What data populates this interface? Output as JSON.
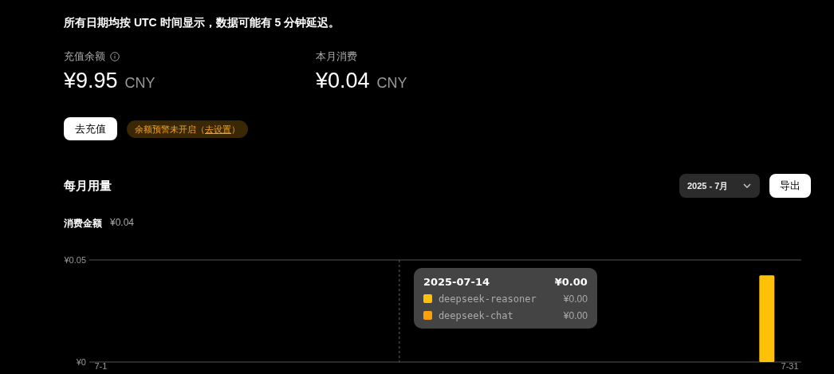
{
  "notice": "所有日期均按 UTC 时间显示，数据可能有 5 分钟延迟。",
  "stats": [
    {
      "label": "充值余额",
      "info": true,
      "amount": "¥9.95",
      "currency": "CNY"
    },
    {
      "label": "本月消费",
      "info": false,
      "amount": "¥0.04",
      "currency": "CNY"
    }
  ],
  "topup_button": "去充值",
  "alert_badge": {
    "text": "余额预警未开启（",
    "link": "去设置",
    "end": "）"
  },
  "usage": {
    "title": "每月用量",
    "month_select": "2025 - 7月",
    "export_button": "导出",
    "total_label": "消费金额",
    "total_value": "¥0.04",
    "chart_data": {
      "type": "bar",
      "categories": [
        "7-1",
        null,
        null,
        null,
        null,
        null,
        null,
        null,
        null,
        null,
        null,
        null,
        null,
        null,
        null,
        null,
        null,
        null,
        null,
        null,
        null,
        null,
        null,
        null,
        null,
        null,
        null,
        null,
        null,
        null,
        "7-31"
      ],
      "ylim": [
        0,
        0.05
      ],
      "yticks": [
        {
          "value": 0,
          "label": "¥0"
        },
        {
          "value": 0.05,
          "label": "¥0.05"
        }
      ],
      "values": [
        0,
        0,
        0,
        0,
        0,
        0,
        0,
        0,
        0,
        0,
        0,
        0,
        0,
        0,
        0,
        0,
        0,
        0,
        0,
        0,
        0,
        0,
        0,
        0,
        0,
        0,
        0,
        0,
        0,
        0.0425,
        0
      ]
    },
    "tooltip": {
      "date": "2025-07-14",
      "total": "¥0.00",
      "rows": [
        {
          "name": "deepseek-reasoner",
          "value": "¥0.00",
          "color": "#ffc107"
        },
        {
          "name": "deepseek-chat",
          "value": "¥0.00",
          "color": "#ff9f0a"
        }
      ]
    }
  }
}
